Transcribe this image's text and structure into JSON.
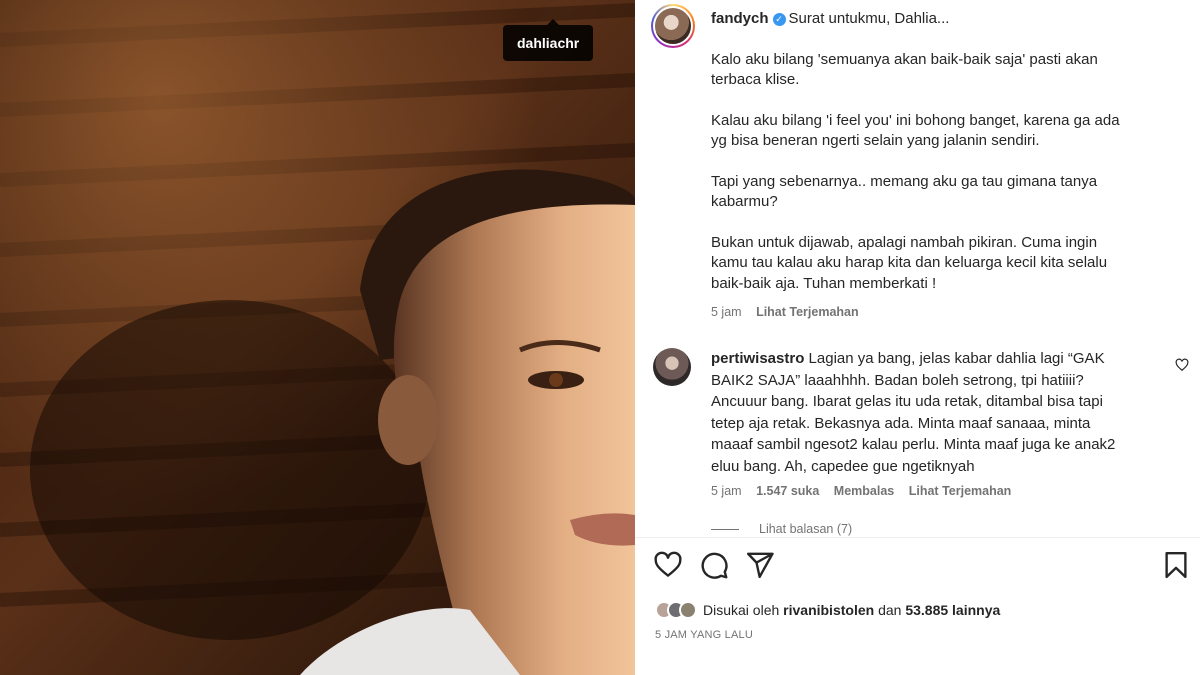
{
  "photo": {
    "tag_username": "dahliachr"
  },
  "post": {
    "author": "fandych",
    "intro": "Surat untukmu, Dahlia...",
    "paragraphs": [
      "Kalo aku bilang 'semuanya akan baik-baik saja' pasti akan terbaca klise.",
      "Kalau aku bilang 'i feel you' ini bohong banget, karena ga ada yg bisa beneran ngerti selain yang jalanin sendiri.",
      "Tapi yang sebenarnya.. memang aku ga tau gimana tanya kabarmu?",
      "Bukan untuk dijawab, apalagi nambah pikiran. Cuma ingin kamu tau kalau aku harap kita dan keluarga kecil kita selalu baik-baik aja. Tuhan memberkati !"
    ],
    "time_ago": "5 jam",
    "translate_label": "Lihat Terjemahan"
  },
  "comment": {
    "author": "pertiwisastro",
    "text": "Lagian ya bang, jelas kabar dahlia lagi “GAK BAIK2 SAJA” laaahhhh. Badan boleh setrong, tpi hatiiii? Ancuuur bang. Ibarat gelas itu uda retak, ditambal bisa tapi tetep aja retak. Bekasnya ada. Minta maaf sanaaa, minta maaaf sambil ngesot2 kalau perlu. Minta maaf juga ke anak2 eluu bang. Ah, capedee gue ngetiknyah",
    "time_ago": "5 jam",
    "likes": "1.547 suka",
    "reply_label": "Membalas",
    "translate_label": "Lihat Terjemahan",
    "view_replies": "Lihat balasan (7)"
  },
  "footer": {
    "liked_by_prefix": "Disukai oleh ",
    "liked_by_user": "rivanibistolen",
    "liked_by_and": " dan ",
    "liked_by_count": "53.885 lainnya",
    "timestamp": "5 JAM YANG LALU"
  },
  "icons": {
    "like": "heart-icon",
    "comment": "comment-icon",
    "share": "send-icon",
    "save": "bookmark-icon",
    "verified": "verified-badge-icon"
  },
  "colors": {
    "verified": "#3897f0",
    "muted": "#737373",
    "text": "#262626"
  }
}
